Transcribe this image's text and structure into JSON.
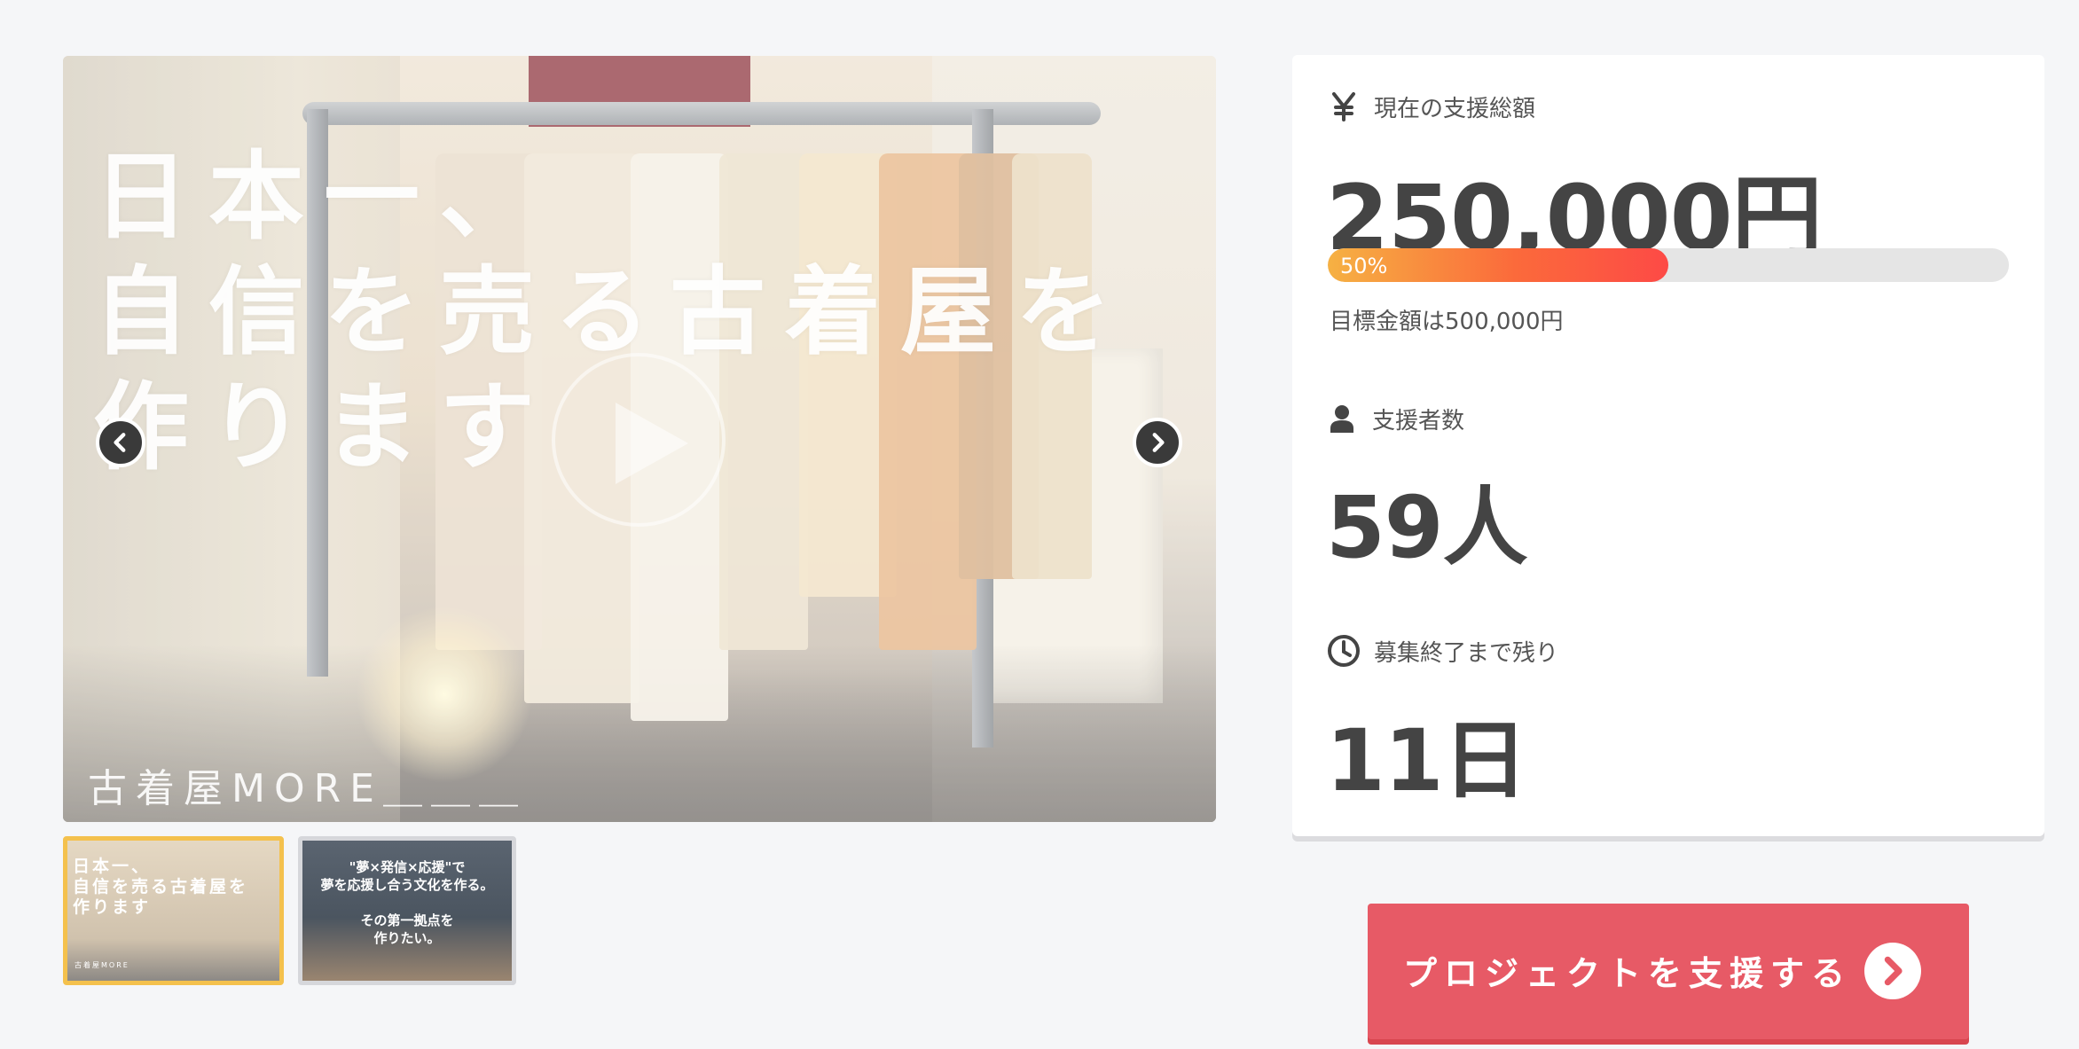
{
  "gallery": {
    "slides": [
      {
        "headline": "日本一、\n自信を売る古着屋を\n作ります",
        "brand": "古着屋MORE＿＿＿"
      },
      {
        "headline": "\"夢×発信×応援\"で\n夢を応援し合う文化を作る。\n\nその第一拠点を\n作りたい。"
      }
    ],
    "thumbnails": [
      {
        "text": "日本一、\n自信を売る古着屋を\n作ります",
        "brand": "古着屋MORE",
        "active": true
      },
      {
        "text": "\"夢×発信×応援\"で\n夢を応援し合う文化を作る。\n\nその第一拠点を\n作りたい。",
        "active": false
      }
    ],
    "icons": {
      "prev": "chevron-left-icon",
      "next": "chevron-right-icon",
      "play": "play-icon"
    }
  },
  "stats": {
    "funding": {
      "icon": "yen-icon",
      "label": "現在の支援総額",
      "value": "250,000円",
      "progress_percent": 50,
      "progress_label": "50%",
      "goal_text": "目標金額は500,000円"
    },
    "backers": {
      "icon": "user-icon",
      "label": "支援者数",
      "value": "59人"
    },
    "remaining": {
      "icon": "clock-icon",
      "label": "募集終了まで残り",
      "value": "11日"
    }
  },
  "cta": {
    "label": "プロジェクトを支援する",
    "icon": "chevron-right-circle-icon"
  },
  "colors": {
    "accent": "#e75a66",
    "progress_start": "#f6b143",
    "progress_end": "#fd4a46",
    "thumb_active_border": "#f4c14d",
    "text": "#444444"
  }
}
